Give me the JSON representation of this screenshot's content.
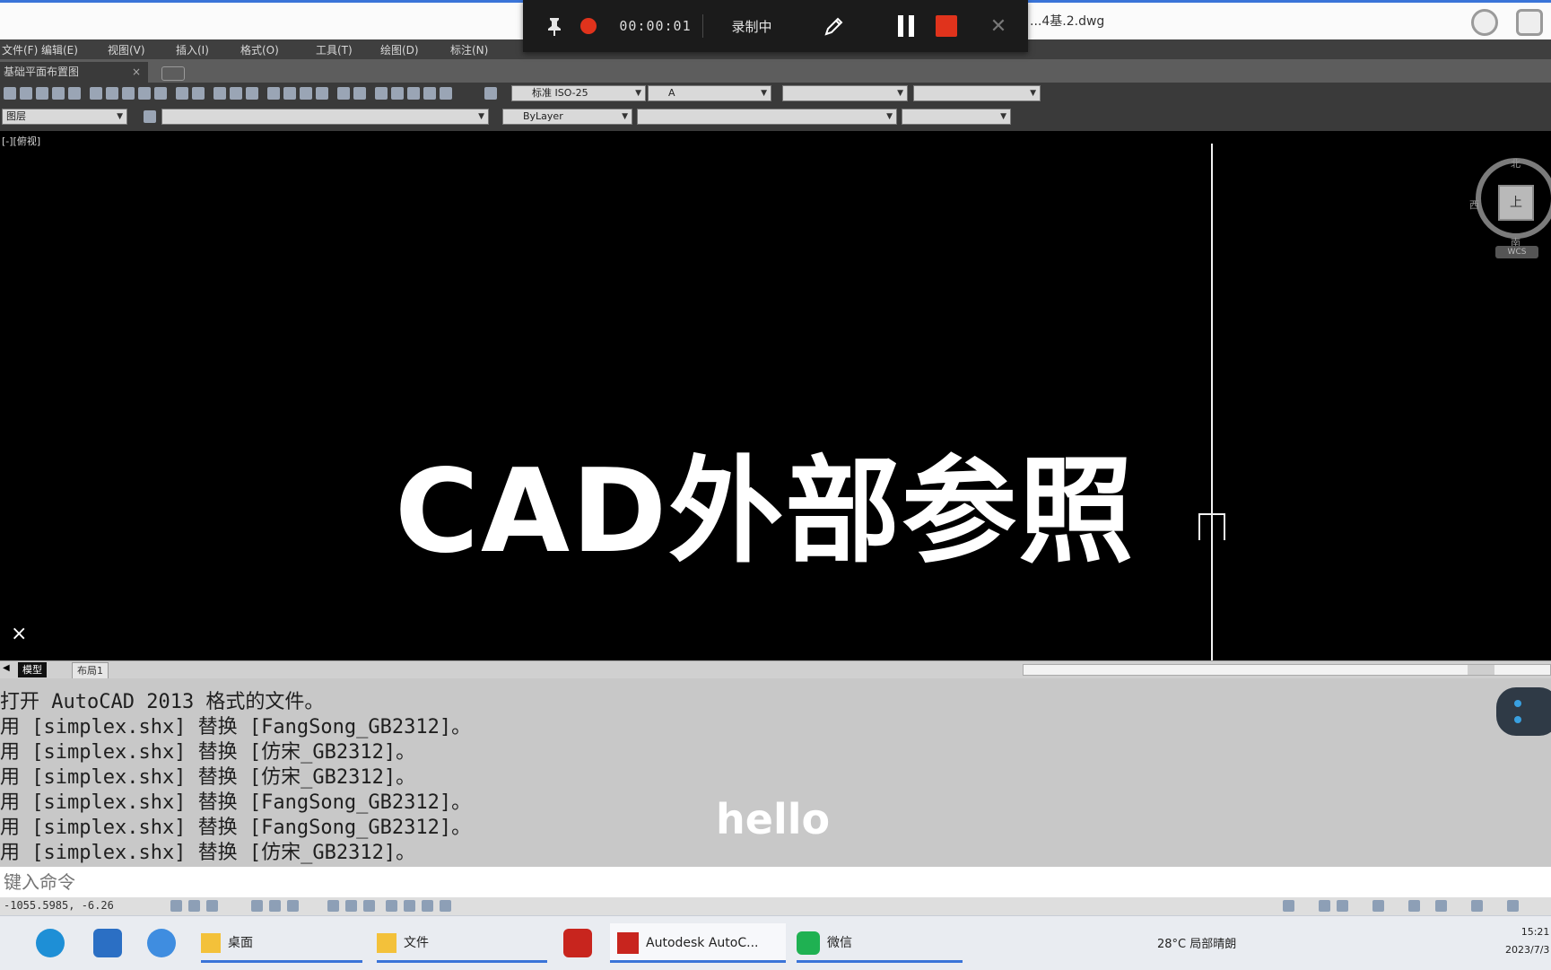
{
  "window": {
    "doc_title": "...4基.2.dwg"
  },
  "recorder": {
    "time": "00:00:01",
    "label": "录制中"
  },
  "menu": [
    "文件(F)",
    "编辑(E)",
    "视图(V)",
    "插入(I)",
    "格式(O)",
    "工具(T)",
    "绘图(D)",
    "标注(N)"
  ],
  "tabs": {
    "document": "基础平面布置图",
    "close": "×"
  },
  "toolbar": {
    "layer_combo": "标准  ISO-25",
    "style_combo": "A",
    "layer_state": "图层",
    "color_combo": "ByLayer"
  },
  "drawing": {
    "view_label": "[-][俯视]",
    "overlay_title": "CAD外部参照",
    "ucs_mark": "×"
  },
  "viewcube": {
    "face": "上",
    "north": "北",
    "west": "西",
    "south": "南",
    "wcs": "WCS"
  },
  "layout": {
    "model": "模型",
    "layout1": "布局1"
  },
  "command": {
    "history": [
      "打开 AutoCAD 2013 格式的文件。",
      "用 [simplex.shx] 替换 [FangSong_GB2312]。",
      "用 [simplex.shx] 替换 [仿宋_GB2312]。",
      "用 [simplex.shx] 替换 [仿宋_GB2312]。",
      "用 [simplex.shx] 替换 [FangSong_GB2312]。",
      "用 [simplex.shx] 替换 [FangSong_GB2312]。",
      "用 [simplex.shx] 替换 [仿宋_GB2312]。"
    ],
    "subtitle": "hello",
    "input_placeholder": "键入命令"
  },
  "status": {
    "coords": "-1055.5985, -6.26"
  },
  "taskbar": {
    "apps": [
      "桌面",
      "文件",
      "Autodesk AutoC...",
      "微信"
    ],
    "tray": "28°C 局部晴朗",
    "time": "15:21",
    "date": "2023/7/3"
  },
  "colors": {
    "accent": "#3a74d8",
    "record": "#e0331c",
    "canvas": "#000000"
  }
}
